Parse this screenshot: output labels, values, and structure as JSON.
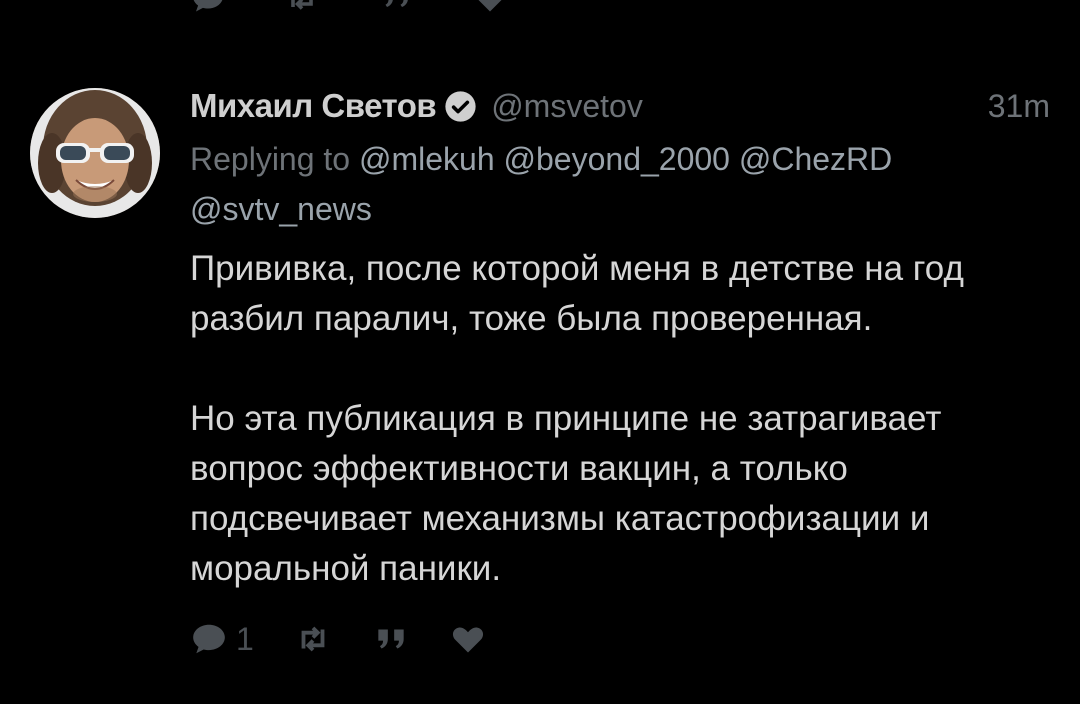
{
  "tweet": {
    "display_name": "Михаил Светов",
    "handle": "@msvetov",
    "timestamp": "31m",
    "verified": true,
    "replying_to_prefix": "Replying to",
    "replying_to": [
      "@mlekuh",
      "@beyond_2000",
      "@ChezRD",
      "@svtv_news"
    ],
    "paragraphs": [
      "Прививка, после которой меня в детстве на год разбил паралич, тоже была проверенная.",
      "Но эта публикация в принципе не затрагивает вопрос эффективности вакцин, а только подсвечивает механизмы катастрофизации и моральной паники."
    ],
    "actions": {
      "reply_count": "1",
      "reply_icon": "reply-icon",
      "retweet_icon": "retweet-icon",
      "quote_icon": "quote-icon",
      "like_icon": "heart-icon"
    }
  },
  "colors": {
    "background": "#000000",
    "name": "#cfcfcf",
    "secondary": "#6e7378",
    "body_text": "#d6d6d6",
    "icons": "#4a4f54"
  }
}
